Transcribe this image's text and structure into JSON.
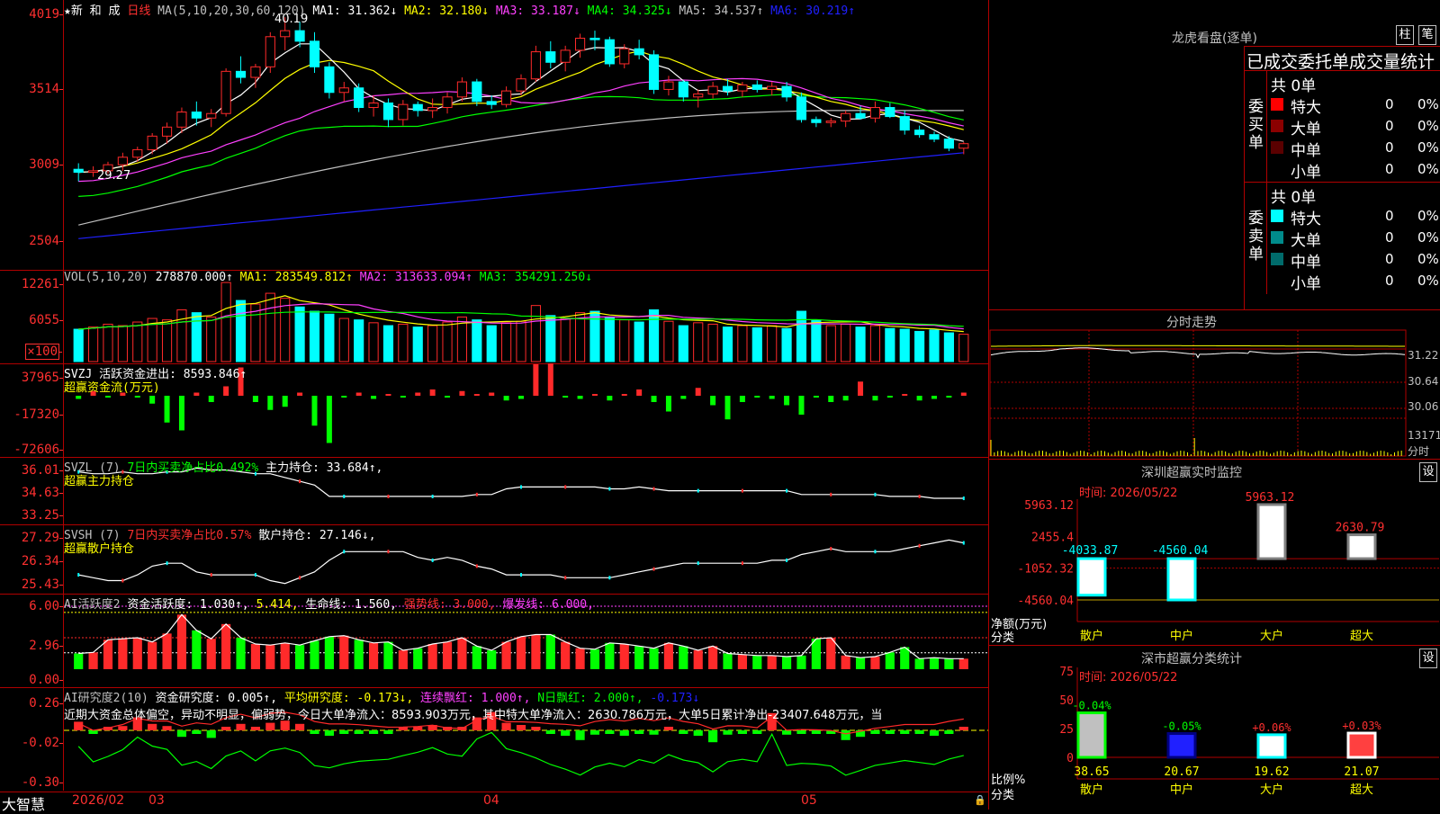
{
  "colors": {
    "up": "#ff2a2a",
    "down": "#00ffff",
    "green": "#00ff00",
    "ma1": "#ffffff",
    "ma2": "#ffff00",
    "ma3": "#ff40ff",
    "ma4": "#00ff00",
    "ma5": "#c0c0c0",
    "ma6": "#2020ff",
    "grid": "#b00000"
  },
  "price": {
    "header": {
      "star": "★新 和 成",
      "period": "日线",
      "ma_label": "MA(5,10,20,30,60,120)",
      "ma1": "MA1: 31.362↓",
      "ma2": "MA2: 32.180↓",
      "ma3": "MA3: 33.187↓",
      "ma4": "MA4: 34.325↓",
      "ma5": "MA5: 34.537↑",
      "ma6": "MA6: 30.219↑"
    },
    "yticks": [
      "4019",
      "3514",
      "3009",
      "2504"
    ],
    "hi_label": "40.19",
    "lo_label": "29.27"
  },
  "volume": {
    "header": {
      "name": "VOL(5,10,20)",
      "value": "278870.000↑",
      "ma1": "MA1: 283549.812↑",
      "ma2": "MA2: 313633.094↑",
      "ma3": "MA3: 354291.250↓"
    },
    "yticks": [
      "12261",
      "6055",
      "×100"
    ]
  },
  "svzj": {
    "header1": "SVZJ  活跃资金进出: 8593.846↑",
    "header2": "超赢资金流(万元)",
    "yticks": [
      "37965",
      "-17320",
      "-72606"
    ]
  },
  "svzl": {
    "header_name": "SVZL (7)",
    "header_ratio": "7日内买卖净占比0.492%",
    "header_pos": "主力持仓: 33.684↑,",
    "header2": "超赢主力持仓",
    "yticks": [
      "36.01",
      "34.63",
      "33.25"
    ]
  },
  "svsh": {
    "header_name": "SVSH (7)",
    "header_ratio": "7日内买卖净占比0.57%",
    "header_pos": "散户持仓: 27.146↓,",
    "header2": "超赢散户持仓",
    "yticks": [
      "27.29",
      "26.34",
      "25.43"
    ]
  },
  "active": {
    "header_name": "AI活跃度2",
    "header_a": "资金活跃度: 1.030↑,",
    "header_b": "5.414,",
    "header_c": "生命线: 1.560,",
    "header_d": "强势线: 3.000,",
    "header_e": "爆发线: 6.000,",
    "yticks": [
      "6.00",
      "2.96",
      "0.00"
    ]
  },
  "research": {
    "header_name": "AI研究度2(10)",
    "header_a": "资金研究度: 0.005↑,",
    "header_b": "平均研究度: -0.173↓,",
    "header_c": "连续飘红: 1.000↑,",
    "header_d": "N日飘红: 2.000↑,",
    "header_e": "-0.173↓",
    "comment": "近期大资金总体偏空，异动不明显，偏弱势，今日大单净流入：8593.903万元，其中特大单净流入：2630.786万元，大单5日累计净出-23407.648万元，当",
    "yticks": [
      "0.26",
      "-0.02",
      "-0.30"
    ]
  },
  "bottom": {
    "brand": "大智慧",
    "date1": "2026/02",
    "m3": "03",
    "m4": "04",
    "m5": "05"
  },
  "dragon": {
    "title": "龙虎看盘(逐单)",
    "btn1": "柱",
    "btn2": "笔",
    "subtitle": "已成交委托单成交量统计",
    "buy": {
      "side": "委买单",
      "total": "共 0单",
      "rows": [
        {
          "name": "特大",
          "v": "0",
          "p": "0%"
        },
        {
          "name": "大单",
          "v": "0",
          "p": "0%"
        },
        {
          "name": "中单",
          "v": "0",
          "p": "0%"
        },
        {
          "name": "小单",
          "v": "0",
          "p": "0%"
        }
      ]
    },
    "sell": {
      "side": "委卖单",
      "total": "共 0单",
      "rows": [
        {
          "name": "特大",
          "v": "0",
          "p": "0%"
        },
        {
          "name": "大单",
          "v": "0",
          "p": "0%"
        },
        {
          "name": "中单",
          "v": "0",
          "p": "0%"
        },
        {
          "name": "小单",
          "v": "0",
          "p": "0%"
        }
      ]
    }
  },
  "intraday": {
    "title": "分时走势",
    "ylabels": [
      "31.22",
      "30.64",
      "30.06",
      "13171",
      "分时"
    ]
  },
  "sz_monitor": {
    "title": "深圳超赢实时监控",
    "btn": "设",
    "time": "时间: 2026/05/22",
    "yticks": [
      "5963.12",
      "2455.4",
      "-1052.32",
      "-4560.04"
    ],
    "ylabel1": "净额(万元)",
    "ylabel2": "分类",
    "chart_data": {
      "type": "bar",
      "categories": [
        "散户",
        "中户",
        "大户",
        "超大"
      ],
      "values": [
        -4033.87,
        -4560.04,
        5963.12,
        2630.79
      ],
      "labels": [
        "-4033.87",
        "-4560.04",
        "5963.12",
        "2630.79"
      ],
      "ylim": [
        -4560.04,
        5963.12
      ]
    }
  },
  "sz_class": {
    "title": "深市超赢分类统计",
    "btn": "设",
    "time": "时间: 2026/05/22",
    "yticks": [
      "75",
      "50",
      "25",
      "0"
    ],
    "ylabel1": "比例%",
    "ylabel2": "分类",
    "chart_data": {
      "type": "bar",
      "categories": [
        "散户",
        "中户",
        "大户",
        "超大"
      ],
      "values": [
        38.65,
        20.67,
        19.62,
        21.07
      ],
      "labels": [
        "38.65",
        "20.67",
        "19.62",
        "21.07"
      ],
      "changes": [
        "-0.04%",
        "-0.05%",
        "+0.06%",
        "+0.03%"
      ],
      "ylim": [
        0,
        75
      ]
    }
  },
  "chart_data": {
    "type": "candlestick",
    "candles": [
      [
        30.1,
        30.5,
        29.3,
        29.9
      ],
      [
        29.9,
        30.3,
        29.6,
        30.0
      ],
      [
        30.0,
        30.6,
        29.8,
        30.4
      ],
      [
        30.4,
        31.2,
        30.0,
        30.9
      ],
      [
        30.9,
        31.6,
        30.6,
        31.4
      ],
      [
        31.4,
        32.5,
        31.1,
        32.3
      ],
      [
        32.3,
        33.2,
        31.8,
        32.9
      ],
      [
        32.9,
        34.2,
        32.5,
        33.9
      ],
      [
        33.9,
        34.6,
        33.0,
        33.5
      ],
      [
        33.5,
        34.1,
        32.9,
        33.8
      ],
      [
        33.8,
        36.8,
        33.6,
        36.6
      ],
      [
        36.6,
        37.6,
        35.8,
        36.2
      ],
      [
        36.2,
        37.1,
        35.5,
        36.9
      ],
      [
        36.9,
        39.2,
        36.5,
        38.9
      ],
      [
        38.9,
        40.19,
        38.0,
        39.3
      ],
      [
        39.3,
        39.9,
        38.2,
        38.6
      ],
      [
        38.6,
        39.2,
        36.5,
        36.9
      ],
      [
        36.9,
        37.2,
        34.8,
        35.2
      ],
      [
        35.2,
        35.9,
        34.6,
        35.5
      ],
      [
        35.5,
        35.8,
        33.9,
        34.2
      ],
      [
        34.2,
        35.0,
        33.6,
        34.5
      ],
      [
        34.5,
        34.8,
        32.9,
        33.4
      ],
      [
        33.4,
        34.7,
        33.0,
        34.4
      ],
      [
        34.4,
        34.6,
        33.6,
        34.0
      ],
      [
        34.0,
        34.8,
        33.5,
        34.2
      ],
      [
        34.2,
        35.2,
        33.8,
        34.9
      ],
      [
        34.9,
        36.2,
        34.6,
        35.9
      ],
      [
        35.9,
        36.1,
        34.3,
        34.6
      ],
      [
        34.6,
        35.0,
        34.1,
        34.4
      ],
      [
        34.4,
        35.6,
        34.2,
        35.3
      ],
      [
        35.3,
        36.4,
        35.0,
        36.1
      ],
      [
        36.1,
        38.3,
        35.9,
        37.9
      ],
      [
        37.9,
        38.6,
        36.8,
        37.2
      ],
      [
        37.2,
        38.3,
        36.6,
        38.0
      ],
      [
        38.0,
        39.1,
        37.5,
        38.8
      ],
      [
        38.8,
        39.3,
        38.0,
        38.7
      ],
      [
        38.7,
        38.9,
        36.9,
        37.1
      ],
      [
        37.1,
        38.4,
        36.8,
        38.1
      ],
      [
        38.1,
        38.7,
        37.4,
        37.7
      ],
      [
        37.7,
        38.0,
        35.1,
        35.4
      ],
      [
        35.4,
        36.3,
        35.0,
        35.9
      ],
      [
        35.9,
        36.0,
        34.6,
        34.9
      ],
      [
        34.9,
        35.4,
        34.2,
        35.1
      ],
      [
        35.1,
        35.9,
        34.8,
        35.6
      ],
      [
        35.6,
        36.1,
        35.0,
        35.3
      ],
      [
        35.3,
        35.9,
        34.9,
        35.7
      ],
      [
        35.7,
        36.0,
        35.2,
        35.4
      ],
      [
        35.4,
        35.9,
        35.0,
        35.6
      ],
      [
        35.6,
        35.9,
        34.6,
        34.9
      ],
      [
        34.9,
        35.2,
        33.2,
        33.4
      ],
      [
        33.4,
        33.6,
        32.9,
        33.2
      ],
      [
        33.2,
        33.5,
        32.9,
        33.3
      ],
      [
        33.3,
        34.0,
        32.9,
        33.8
      ],
      [
        33.8,
        34.3,
        33.4,
        33.5
      ],
      [
        33.5,
        34.6,
        33.2,
        34.2
      ],
      [
        34.2,
        34.5,
        33.5,
        33.6
      ],
      [
        33.6,
        34.0,
        32.4,
        32.7
      ],
      [
        32.7,
        33.0,
        32.2,
        32.4
      ],
      [
        32.4,
        32.6,
        31.9,
        32.1
      ],
      [
        32.1,
        32.3,
        31.3,
        31.5
      ],
      [
        31.5,
        31.9,
        31.1,
        31.8
      ]
    ],
    "volume": [
      45,
      48,
      52,
      50,
      55,
      60,
      58,
      72,
      68,
      62,
      110,
      85,
      80,
      95,
      88,
      76,
      70,
      66,
      60,
      58,
      54,
      50,
      52,
      48,
      50,
      55,
      62,
      58,
      50,
      54,
      56,
      78,
      64,
      60,
      68,
      70,
      62,
      58,
      55,
      72,
      56,
      50,
      54,
      52,
      48,
      50,
      47,
      50,
      46,
      70,
      58,
      50,
      52,
      48,
      50,
      46,
      45,
      42,
      44,
      40,
      38
    ],
    "svzj": [
      -2,
      3,
      -1,
      2,
      -1,
      -5,
      -17,
      -22,
      2,
      -4,
      6,
      18,
      -4,
      -9,
      -7,
      2,
      -19,
      -30,
      -1,
      2,
      -2,
      1,
      -1,
      2,
      4,
      -1,
      3,
      1,
      2,
      -3,
      -2,
      20,
      22,
      -1,
      -2,
      1,
      -3,
      1,
      4,
      -4,
      -10,
      -2,
      5,
      -6,
      -15,
      -4,
      -1,
      -2,
      -6,
      -12,
      -1,
      -4,
      -3,
      9,
      -3,
      -1,
      1,
      -3,
      -2,
      -1,
      2
    ],
    "svzl": [
      35.6,
      35.5,
      35.5,
      35.6,
      35.5,
      35.5,
      35.6,
      35.6,
      35.8,
      35.7,
      35.7,
      35.6,
      35.5,
      35.5,
      35.3,
      35.1,
      34.9,
      34.3,
      34.3,
      34.3,
      34.3,
      34.3,
      34.3,
      34.3,
      34.3,
      34.3,
      34.3,
      34.4,
      34.4,
      34.7,
      34.8,
      34.8,
      34.8,
      34.8,
      34.8,
      34.8,
      34.7,
      34.7,
      34.8,
      34.7,
      34.6,
      34.6,
      34.6,
      34.6,
      34.6,
      34.6,
      34.6,
      34.6,
      34.6,
      34.4,
      34.4,
      34.4,
      34.4,
      34.4,
      34.4,
      34.3,
      34.3,
      34.3,
      34.2,
      34.2,
      34.2
    ],
    "svsh": [
      25.8,
      25.7,
      25.6,
      25.6,
      25.8,
      26.1,
      26.2,
      26.2,
      25.9,
      25.8,
      25.8,
      25.8,
      25.8,
      25.6,
      25.5,
      25.7,
      25.9,
      26.3,
      26.6,
      26.6,
      26.6,
      26.6,
      26.6,
      26.4,
      26.3,
      26.4,
      26.3,
      26.1,
      26.0,
      25.8,
      25.8,
      25.8,
      25.8,
      25.7,
      25.7,
      25.7,
      25.7,
      25.8,
      25.9,
      26.0,
      26.1,
      26.2,
      26.2,
      26.2,
      26.2,
      26.2,
      26.2,
      26.3,
      26.3,
      26.5,
      26.6,
      26.7,
      26.6,
      26.6,
      26.6,
      26.6,
      26.7,
      26.8,
      26.9,
      27.0,
      26.9
    ],
    "active": [
      1.5,
      1.6,
      2.8,
      2.9,
      3.0,
      2.6,
      3.4,
      5.2,
      3.7,
      2.9,
      4.3,
      3.0,
      2.4,
      2.3,
      2.5,
      2.3,
      2.7,
      3.1,
      3.2,
      2.8,
      2.5,
      2.6,
      1.8,
      2.0,
      2.4,
      2.6,
      3.0,
      2.2,
      1.8,
      2.6,
      3.1,
      3.3,
      3.3,
      2.6,
      2.0,
      1.9,
      2.5,
      2.4,
      2.2,
      2.0,
      2.5,
      2.2,
      1.8,
      2.2,
      1.5,
      1.4,
      1.3,
      1.3,
      1.2,
      1.3,
      2.9,
      3.0,
      1.3,
      1.1,
      1.2,
      1.6,
      2.1,
      1.0,
      1.1,
      1.0,
      1.0
    ],
    "research": [
      0.08,
      -0.03,
      0.0,
      0.04,
      0.12,
      0.06,
      0.04,
      -0.06,
      -0.03,
      -0.07,
      0.02,
      0.06,
      0.0,
      0.07,
      0.09,
      0.06,
      -0.03,
      -0.05,
      -0.03,
      -0.02,
      -0.02,
      -0.02,
      0.0,
      0.02,
      0.05,
      0.01,
      0.0,
      0.12,
      0.17,
      0.07,
      0.05,
      0.02,
      -0.02,
      -0.05,
      -0.09,
      -0.04,
      -0.02,
      -0.05,
      -0.01,
      -0.04,
      0.01,
      -0.03,
      -0.05,
      -0.11,
      -0.04,
      -0.02,
      -0.03,
      0.16,
      -0.04,
      -0.02,
      -0.02,
      -0.03,
      -0.09,
      -0.06,
      -0.03,
      -0.02,
      -0.01,
      -0.03,
      -0.05,
      -0.02,
      0.0
    ]
  }
}
